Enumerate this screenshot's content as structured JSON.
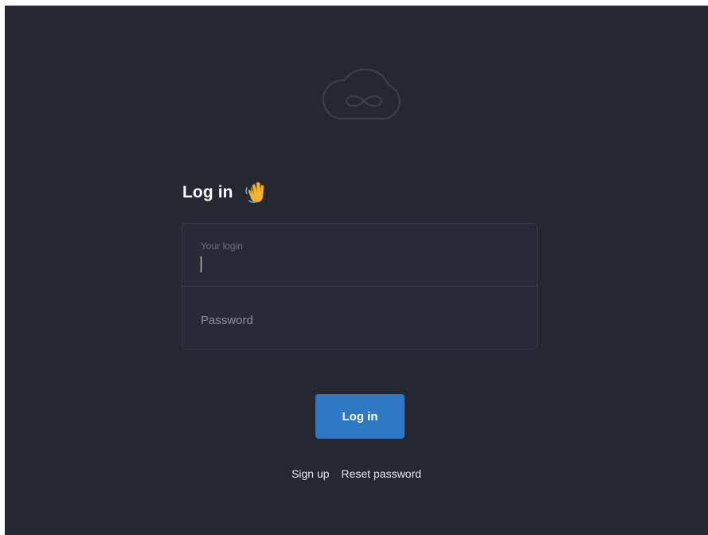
{
  "logo": {
    "icon": "cloud-infinity-icon"
  },
  "heading": {
    "title": "Log in",
    "emoji_icon": "waving-hand-icon"
  },
  "form": {
    "login_label": "Your login",
    "password_placeholder": "Password"
  },
  "actions": {
    "login_button_label": "Log in",
    "signup_link": "Sign up",
    "reset_password_link": "Reset password"
  },
  "colors": {
    "background": "#252733",
    "field_background": "#282a37",
    "border": "#373a48",
    "accent": "#2f78c4"
  }
}
